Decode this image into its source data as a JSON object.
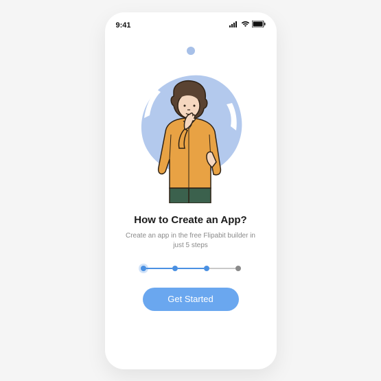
{
  "statusBar": {
    "time": "9:41"
  },
  "onboarding": {
    "title": "How to Create an App?",
    "subtitle": "Create an app in the free Flipabit builder in just 5 steps",
    "cta": "Get Started",
    "totalSteps": 4,
    "currentStep": 3
  },
  "colors": {
    "accent": "#6aa7ef",
    "progress": "#4a90e2",
    "blob": "#b3c9ed",
    "shirt": "#e8a244",
    "pants": "#3b614d",
    "hair": "#5a4332",
    "skin": "#f5d7bf"
  },
  "icons": {
    "signal": "signal-icon",
    "wifi": "wifi-icon",
    "battery": "battery-icon"
  }
}
